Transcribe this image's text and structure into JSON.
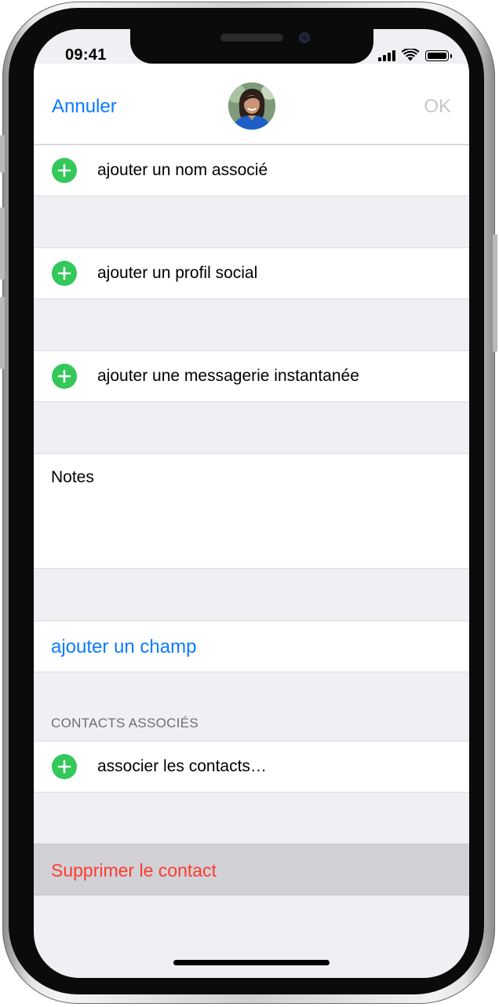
{
  "status_bar": {
    "time": "09:41"
  },
  "nav": {
    "cancel_label": "Annuler",
    "ok_label": "OK",
    "avatar_icon": "contact-photo"
  },
  "rows": {
    "associated_name": "ajouter un nom associé",
    "social_profile": "ajouter un profil social",
    "instant_message": "ajouter une messagerie instantanée",
    "notes_label": "Notes",
    "add_field": "ajouter un champ",
    "linked_contacts_header": "CONTACTS ASSOCIÉS",
    "link_contacts": "associer les contacts…",
    "delete_contact": "Supprimer le contact"
  },
  "colors": {
    "accent": "#0a7bff",
    "add": "#34c759",
    "destructive": "#ff3b30",
    "background": "#efeff4"
  }
}
